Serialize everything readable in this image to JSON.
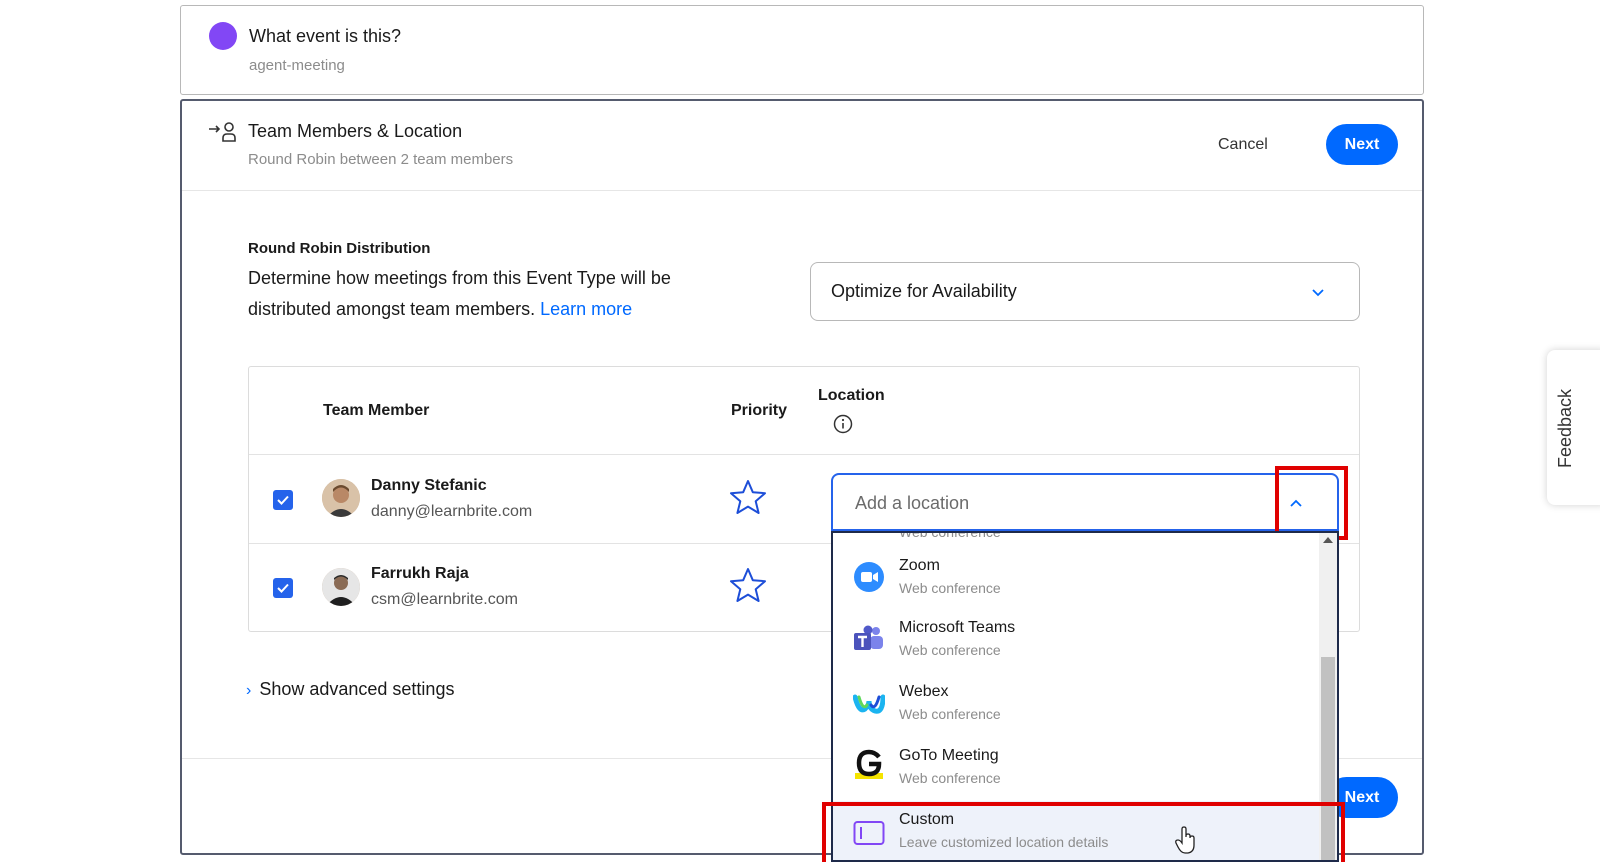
{
  "event": {
    "title": "What event is this?",
    "subtitle": "agent-meeting",
    "dot_color": "#8247f5"
  },
  "team_section": {
    "title": "Team Members & Location",
    "subtitle": "Round Robin between 2 team members",
    "cancel_label": "Cancel",
    "next_label": "Next"
  },
  "round_robin": {
    "heading": "Round Robin Distribution",
    "description": "Determine how meetings from this Event Type will be distributed amongst team members.",
    "learn_more": "Learn more",
    "selected_option": "Optimize for Availability"
  },
  "table": {
    "headers": {
      "team_member": "Team Member",
      "priority": "Priority",
      "location": "Location"
    },
    "rows": [
      {
        "name": "Danny Stefanic",
        "email": "danny@learnbrite.com",
        "checked": true
      },
      {
        "name": "Farrukh Raja",
        "email": "csm@learnbrite.com",
        "checked": true
      }
    ]
  },
  "location_input": {
    "placeholder": "Add a location"
  },
  "location_options": [
    {
      "name": "Zoom",
      "sub": "Web conference",
      "icon": "zoom-icon"
    },
    {
      "name": "Microsoft Teams",
      "sub": "Web conference",
      "icon": "microsoft-teams-icon"
    },
    {
      "name": "Webex",
      "sub": "Web conference",
      "icon": "webex-icon"
    },
    {
      "name": "GoTo Meeting",
      "sub": "Web conference",
      "icon": "goto-meeting-icon"
    },
    {
      "name": "Custom",
      "sub": "Leave customized location details",
      "icon": "custom-location-icon"
    }
  ],
  "partial_option_sub": "Web conference",
  "advanced": {
    "label": "Show advanced settings"
  },
  "footer": {
    "next_label": "Next"
  },
  "feedback": {
    "label": "Feedback"
  },
  "colors": {
    "accent": "#0069ff",
    "highlight": "#e00000",
    "checkbox": "#2563eb"
  }
}
